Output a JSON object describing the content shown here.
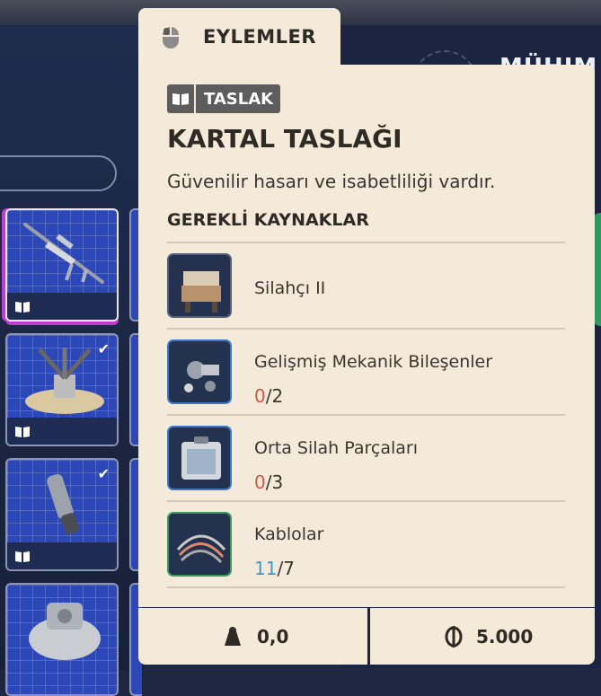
{
  "tab": {
    "label": "EYLEMLER",
    "icon": "mouse-icon"
  },
  "right_panel": {
    "title_fragment": "MÜHIM"
  },
  "inventory": {
    "tiles": [
      {
        "name": "sniper-rifle",
        "checked": false,
        "selected": true
      },
      {
        "name": "turret-gadget",
        "checked": true,
        "selected": false
      },
      {
        "name": "barrel-part",
        "checked": true,
        "selected": false
      },
      {
        "name": "machine-part",
        "checked": false,
        "selected": false
      }
    ],
    "bookmark_icon": "book-icon",
    "check_icon": "checkmark-icon",
    "check_glyph": "✔"
  },
  "detail": {
    "badge": {
      "icon": "book-icon",
      "label": "TASLAK"
    },
    "title": "KARTAL TASLAĞI",
    "description": "Güvenilir hasarı ve isabetliliği vardır.",
    "requirements_header": "GEREKLİ KAYNAKLAR",
    "requirements": [
      {
        "name": "Silahçı II",
        "have": null,
        "need": null,
        "thumb": "workbench",
        "have_color": null
      },
      {
        "name": "Gelişmiş Mekanik Bileşenler",
        "have": "0",
        "need": "/2",
        "thumb": "mechanical-parts",
        "have_color": "#d0584d"
      },
      {
        "name": "Orta Silah Parçaları",
        "have": "0",
        "need": "/3",
        "thumb": "weapon-parts-case",
        "have_color": "#d0584d"
      },
      {
        "name": "Kablolar",
        "have": "11",
        "need": "/7",
        "thumb": "cables",
        "have_color": "#3f97d0"
      }
    ]
  },
  "footer": {
    "weight": {
      "icon": "weight-icon",
      "value": "0,0"
    },
    "price": {
      "icon": "coin-icon",
      "value": "5.000"
    }
  },
  "colors": {
    "panel": "#f3ead9",
    "tile_blue": "#2b47b8",
    "highlight": "#c23bd3"
  }
}
